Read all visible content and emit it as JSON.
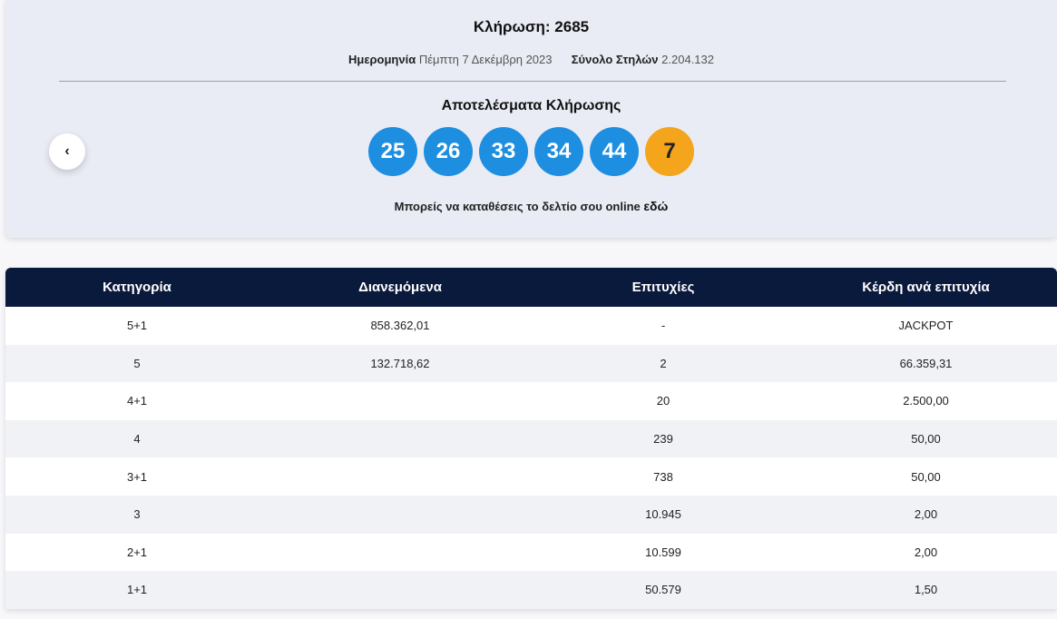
{
  "draw": {
    "title": "Κλήρωση: 2685",
    "date_label": "Ημερομηνία",
    "date_value": "Πέμπτη 7 Δεκέμβρη 2023",
    "columns_label": "Σύνολο Στηλών",
    "columns_value": "2.204.132",
    "results_title": "Αποτελέσματα Κλήρωσης",
    "prev_icon": "‹",
    "numbers": [
      "25",
      "26",
      "33",
      "34",
      "44"
    ],
    "bonus": "7",
    "online_text": "Μπορείς να καταθέσεις το δελτίο σου online",
    "online_link": "εδώ"
  },
  "colors": {
    "ball_main": "#1e8ee0",
    "ball_bonus": "#f4a51c",
    "header_bg": "#0a1a3c"
  },
  "table": {
    "headers": [
      "Κατηγορία",
      "Διανεμόμενα",
      "Επιτυχίες",
      "Κέρδη ανά επιτυχία"
    ],
    "rows": [
      [
        "5+1",
        "858.362,01",
        "-",
        "JACKPOT"
      ],
      [
        "5",
        "132.718,62",
        "2",
        "66.359,31"
      ],
      [
        "4+1",
        "",
        "20",
        "2.500,00"
      ],
      [
        "4",
        "",
        "239",
        "50,00"
      ],
      [
        "3+1",
        "",
        "738",
        "50,00"
      ],
      [
        "3",
        "",
        "10.945",
        "2,00"
      ],
      [
        "2+1",
        "",
        "10.599",
        "2,00"
      ],
      [
        "1+1",
        "",
        "50.579",
        "1,50"
      ]
    ]
  }
}
